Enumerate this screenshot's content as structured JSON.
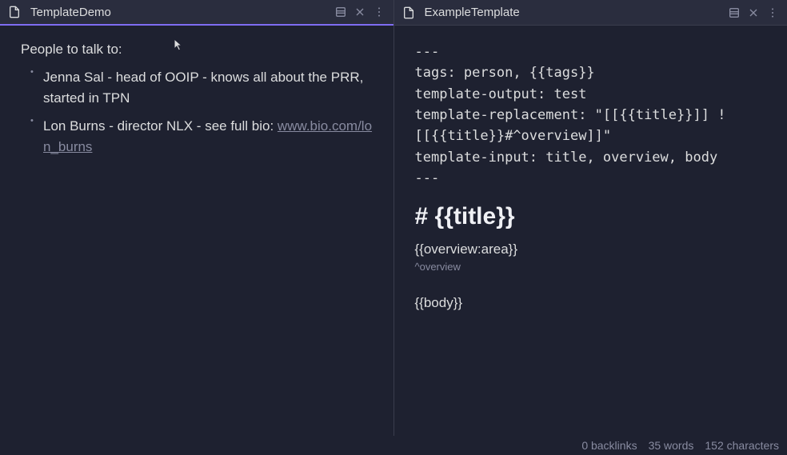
{
  "panes": {
    "left": {
      "title": "TemplateDemo",
      "heading": "People to talk to:",
      "people": [
        {
          "text": "Jenna Sal - head of OOIP - knows all about the PRR, started in TPN",
          "linkLabel": "",
          "linkUrl": ""
        },
        {
          "text": "Lon Burns - director NLX - see full bio: ",
          "linkLabel": "www.bio.com/lon_burns",
          "linkUrl": "www.bio.com/lon_burns"
        }
      ]
    },
    "right": {
      "title": "ExampleTemplate",
      "frontmatter": "---\ntags: person, {{tags}}\ntemplate-output: test\ntemplate-replacement: \"[[{{title}}]] ![[{{title}}#^overview]]\"\ntemplate-input: title, overview, body\n---",
      "titleHeading": "# {{title}}",
      "overviewPlaceholder": "{{overview:area}}",
      "overviewRef": "^overview",
      "bodyPlaceholder": "{{body}}"
    }
  },
  "status": {
    "backlinks": "0 backlinks",
    "words": "35 words",
    "characters": "152 characters"
  }
}
